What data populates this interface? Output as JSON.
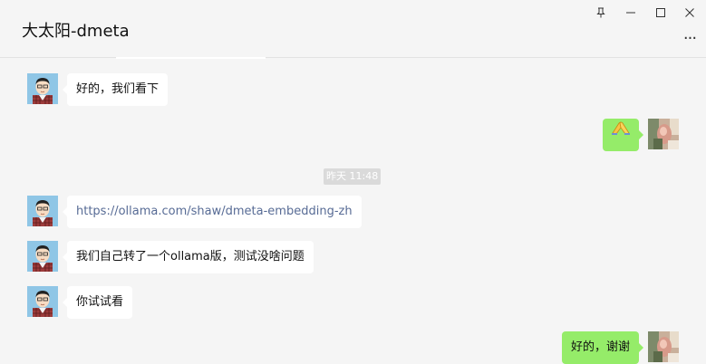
{
  "chat": {
    "title": "大太阳-dmeta"
  },
  "window_controls": {
    "pin_icon": "pin-icon",
    "minimize_icon": "minimize-icon",
    "maximize_icon": "maximize-icon",
    "close_icon": "close-icon",
    "more_icon": "more-icon",
    "more_label": "..."
  },
  "messages": [
    {
      "direction": "in",
      "type": "text",
      "text": "好的，我们看下"
    },
    {
      "direction": "out",
      "type": "emoji",
      "emoji": "🙏",
      "icon": "praying-hands-icon"
    },
    {
      "direction": "in",
      "type": "link",
      "text": "https://ollama.com/shaw/dmeta-embedding-zh"
    },
    {
      "direction": "in",
      "type": "text",
      "text": "我们自己转了一个ollama版，测试没啥问题"
    },
    {
      "direction": "in",
      "type": "text",
      "text": "你试试看"
    },
    {
      "direction": "out",
      "type": "text",
      "text": "好的，谢谢"
    }
  ],
  "timestamp": "昨天 11:48",
  "colors": {
    "outgoing_bubble": "#95ec69",
    "incoming_bubble": "#ffffff",
    "link": "#576b95",
    "background": "#f5f5f5",
    "timestamp_bg": "#dadada"
  }
}
